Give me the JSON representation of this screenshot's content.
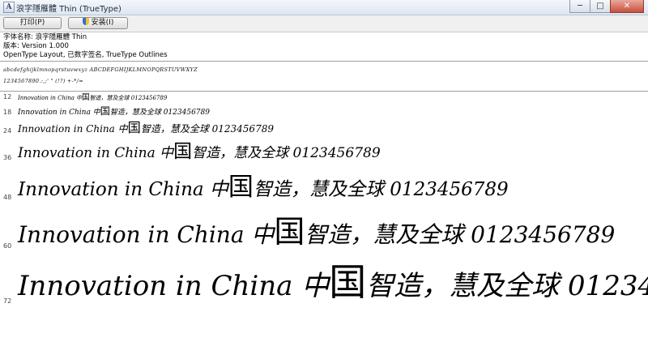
{
  "window": {
    "title": "浪字隱雁體 Thin (TrueType)",
    "minimize_glyph": "─",
    "maximize_glyph": "□",
    "close_glyph": "✕"
  },
  "toolbar": {
    "print_label": "打印(P)",
    "install_label": "安装(I)"
  },
  "font_info": {
    "name_line": "字体名称: 浪字隱雁體 Thin",
    "version_line": "版本: Version 1.000",
    "features_line": "OpenType Layout, 已数字签名, TrueType Outlines"
  },
  "charset": {
    "line1": "abcdefghijklmnopqrstuvwxyz ABCDEFGHIJKLMNOPQRSTUVWXYZ",
    "line2": "1234567890.:,;' \" (!?) +-*/="
  },
  "sample": {
    "prefix": "Innovation in China 中",
    "big_char": "国",
    "suffix": "智造，慧及全球 0123456789"
  },
  "sizes": [
    "12",
    "18",
    "24",
    "36",
    "48",
    "60",
    "72"
  ],
  "colors": {
    "title_bar": "#dde6f2",
    "toolbar_bg": "#f0f0f0",
    "close_button": "#c7503b",
    "separator": "#9f9f9f"
  }
}
